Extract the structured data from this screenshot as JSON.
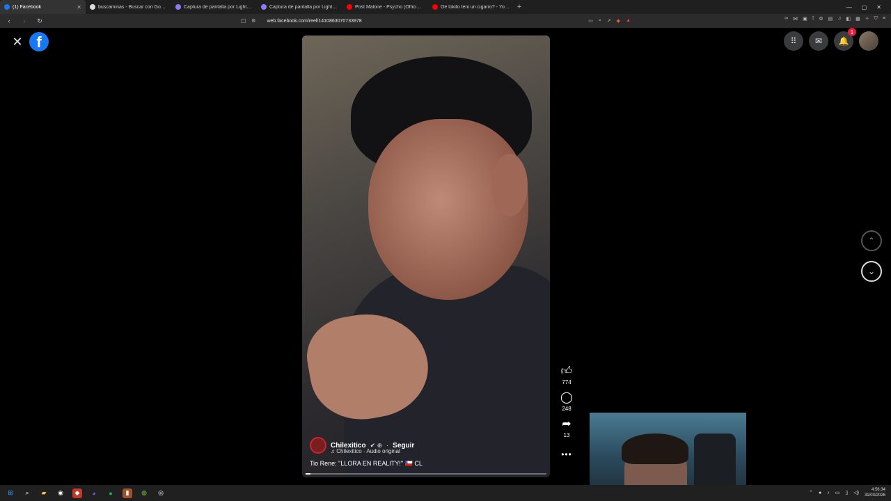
{
  "browser": {
    "tabs": [
      {
        "title": "(1) Facebook",
        "active": true,
        "favicon_color": "#1877f2"
      },
      {
        "title": "buscaminas - Buscar con Google",
        "active": false,
        "favicon_color": "#dddddd"
      },
      {
        "title": "Captura de pantalla por Lightshot",
        "active": false,
        "favicon_color": "#8a7cff"
      },
      {
        "title": "Captura de pantalla por Lightshot",
        "active": false,
        "favicon_color": "#8a7cff"
      },
      {
        "title": "Post Malone - Psycho (Official Music",
        "active": false,
        "favicon_color": "#ff0000"
      },
      {
        "title": "Oe lokito teni un cigarro? - YouTube",
        "active": false,
        "favicon_color": "#ff0000"
      }
    ],
    "new_tab": "+",
    "url": "web.facebook.com/reel/1410863070733978"
  },
  "reel": {
    "author": "Chilexitico",
    "follow_label": "Seguir",
    "audio": "Chilexitico · Audio original",
    "caption": "Tio Rene: \"LLORA EN REALITY!\" 🇨🇱 CL",
    "likes": "774",
    "comments": "248",
    "shares": "13",
    "progress_fraction": 0.02
  },
  "header": {
    "notification_count": "1"
  },
  "taskbar": {
    "time": "4:56:34",
    "date": "31/03/2026"
  },
  "colors": {
    "facebook_blue": "#1877f2",
    "notification_red": "#e41e3f"
  }
}
